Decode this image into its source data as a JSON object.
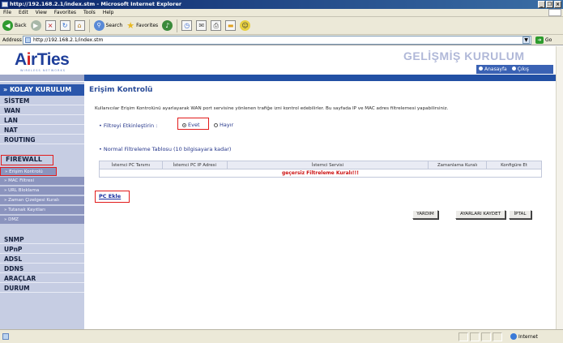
{
  "window": {
    "title": "http://192.168.2.1/index.stm - Microsoft Internet Explorer",
    "buttons": [
      "_",
      "❐",
      "×"
    ]
  },
  "menubar": [
    "File",
    "Edit",
    "View",
    "Favorites",
    "Tools",
    "Help"
  ],
  "toolbar": {
    "back_label": "Back",
    "search_label": "Search",
    "favorites_label": "Favorites"
  },
  "address": {
    "label": "Address",
    "value": "http://192.168.2.1/index.stm",
    "go_label": "Go"
  },
  "header": {
    "logo": "AirTies",
    "logo_prefix": "A",
    "logo_i": "i",
    "logo_rest": "rTies",
    "slogan": "WIRELESS NETWORKS",
    "title": "GELİŞMİŞ KURULUM",
    "link_home": "Anasayfa",
    "link_exit": "Çıkış"
  },
  "sidebar": {
    "section": "» KOLAY KURULUM",
    "items_top": [
      "SİSTEM",
      "WAN",
      "LAN",
      "NAT",
      "ROUTING",
      "FIREWALL"
    ],
    "subitems": [
      "» Erişim Kontrolü",
      "» MAC Filtresi",
      "» URL Bloklama",
      "» Zaman Çizelgesi Kuralı",
      "» Tutanak Kayıtları",
      "» DMZ"
    ],
    "items_bottom": [
      "SNMP",
      "UPnP",
      "ADSL",
      "DDNS",
      "ARAÇLAR",
      "DURUM"
    ]
  },
  "main": {
    "title": "Erişim Kontrolü",
    "description": "Kullanıcılar Erişim Kontrolünü ayarlayarak WAN port servisine yönlenen trafiğe izni kontrol edebilirler. Bu sayfada IP ve MAC adres filtrelemesi yapabilirsiniz.",
    "filter_label": "Filtreyi Etkinleştirin :",
    "option_yes": "Evet",
    "option_no": "Hayır",
    "table_title": "Normal Filtreleme Tablosu (10 bilgisayara kadar)",
    "table_headers": [
      "İstemci PC Tanımı",
      "İstemci PC IP Adresi",
      "İstemci Servisi",
      "Zamanlama Kuralı",
      "Konfigüre Et"
    ],
    "table_empty": "geçersiz Filtreleme Kuralı!!!",
    "pc_add": "PC Ekle",
    "buttons": {
      "help": "YARDIM",
      "save": "AYARLARI KAYDET",
      "cancel": "İPTAL"
    }
  },
  "status": {
    "zone": "Internet"
  }
}
